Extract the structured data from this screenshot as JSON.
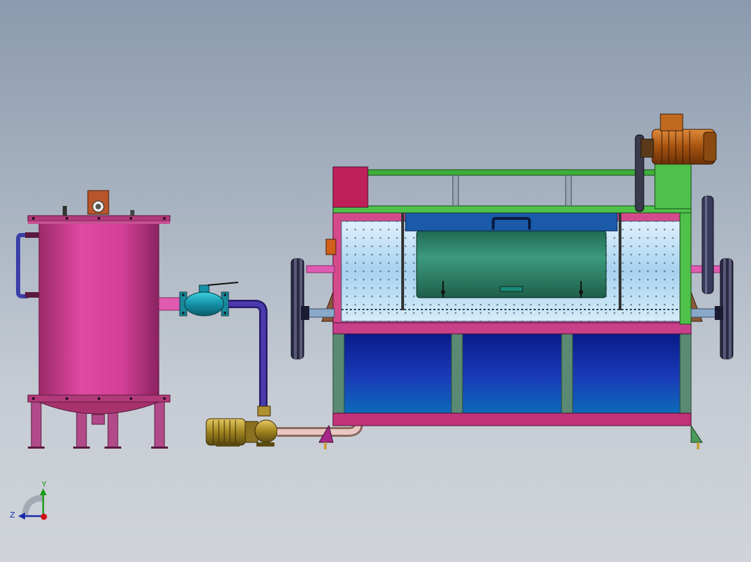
{
  "scene": {
    "colors": {
      "tank": "#d8409a",
      "frame": "#c02a6e",
      "green": "#4fc04a",
      "blue_panel": "#1033a8",
      "drum": "#a9d8f0",
      "motor": "#b8651c",
      "pipe_purple": "#3a2a8e",
      "valve": "#1aa8b8"
    }
  },
  "triad": {
    "y_label": "Y",
    "z_label": "Z"
  }
}
